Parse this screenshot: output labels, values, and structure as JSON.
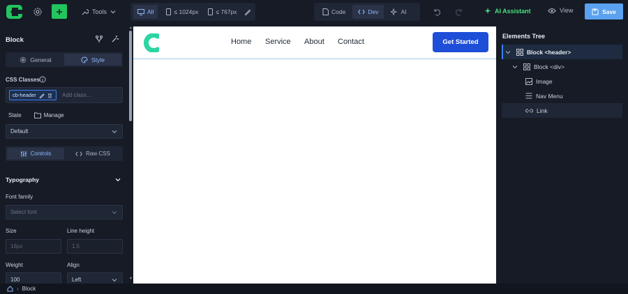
{
  "toolbar": {
    "tools_label": "Tools",
    "devices": [
      {
        "label": "All",
        "active": true
      },
      {
        "label": "≤ 1024px",
        "active": false
      },
      {
        "label": "≤ 767px",
        "active": false
      }
    ],
    "modes": [
      {
        "label": "Code",
        "active": false
      },
      {
        "label": "Dev",
        "active": true
      },
      {
        "label": "AI",
        "active": false
      }
    ],
    "ai_assistant_label": "AI Assistant",
    "view_label": "View",
    "save_label": "Save"
  },
  "left_panel": {
    "title": "Block",
    "tabs": [
      {
        "label": "General",
        "icon": "gear-icon",
        "active": false
      },
      {
        "label": "Style",
        "icon": "palette-icon",
        "active": true
      }
    ],
    "css_classes_label": "CSS Classes",
    "class_chip": "cb-header",
    "add_class_placeholder": "Add class...",
    "state_label": "State",
    "manage_label": "Manage",
    "state_value": "Default",
    "controls_tabs": [
      {
        "label": "Controls",
        "active": true
      },
      {
        "label": "Raw CSS",
        "active": false
      }
    ],
    "typography_title": "Typography",
    "font_family_label": "Font family",
    "font_family_placeholder": "Select font",
    "size_label": "Size",
    "size_placeholder": "16px",
    "line_height_label": "Line height",
    "line_height_placeholder": "1.5",
    "weight_label": "Weight",
    "weight_value": "100",
    "align_label": "Align",
    "align_value": "Left"
  },
  "canvas": {
    "nav": [
      "Home",
      "Service",
      "About",
      "Contact"
    ],
    "cta_label": "Get Started"
  },
  "right_panel": {
    "title": "Elements Tree",
    "items": [
      {
        "label": "Block <header>",
        "icon": "grid-icon"
      },
      {
        "label": "Block <div>",
        "icon": "grid-icon"
      },
      {
        "label": "Image",
        "icon": "image-icon"
      },
      {
        "label": "Nav Menu",
        "icon": "menu-icon"
      },
      {
        "label": "Link",
        "icon": "link-icon"
      }
    ]
  },
  "status_bar": {
    "breadcrumb": "Block"
  },
  "colors": {
    "accent": "#3b82f6",
    "add_button": "#22c55e",
    "ai_assistant": "#4ade80",
    "save": "#5aa2f0",
    "cta": "#1d4ed8",
    "logo": "#2dd4a4"
  }
}
